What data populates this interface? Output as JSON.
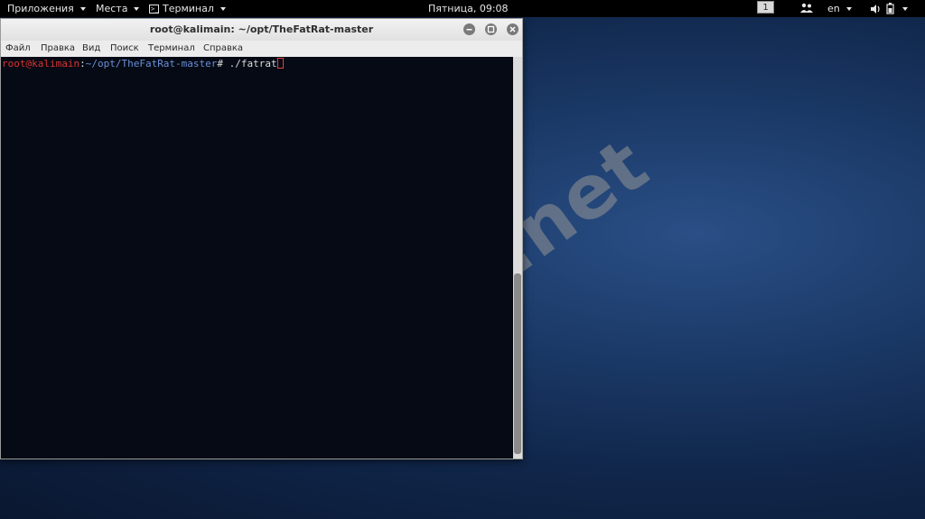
{
  "top_panel": {
    "applications": "Приложения",
    "places": "Места",
    "terminal": "Терминал",
    "clock": "Пятница, 09:08",
    "workspace": "1",
    "keyboard_layout": "en"
  },
  "window": {
    "title": "root@kalimain: ~/opt/TheFatRat-master",
    "menu": [
      "Файл",
      "Правка",
      "Вид",
      "Поиск",
      "Терминал",
      "Справка"
    ]
  },
  "terminal": {
    "user_host": "root@kalimain",
    "separator": ":",
    "path": "~/opt/TheFatRat-master",
    "prompt_char": "# ",
    "command": "./fatrat"
  },
  "watermark": "codeby.net",
  "icons": {
    "terminal_app": "terminal-icon",
    "workspace": "workspace-indicator",
    "people": "user-people-icon",
    "volume": "volume-icon",
    "power": "power-battery-icon",
    "minimize": "minimize-icon",
    "maximize": "maximize-icon",
    "close": "close-icon"
  },
  "colors": {
    "prompt_user": "#d83434",
    "prompt_path": "#6a8fd8",
    "terminal_bg": "#050a14"
  }
}
